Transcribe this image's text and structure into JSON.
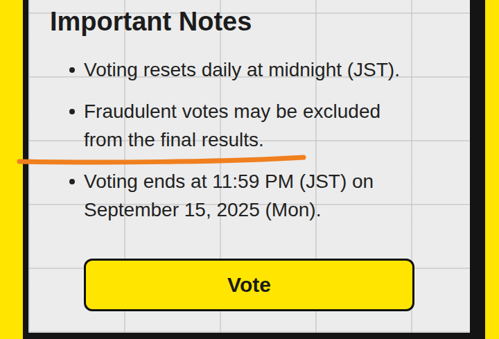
{
  "heading": "Important Notes",
  "notes": [
    {
      "text": "Voting resets daily at midnight (JST).",
      "underlined": false
    },
    {
      "text": "Fraudulent votes may be excluded from the final results.",
      "underlined": true
    },
    {
      "text": "Voting ends at 11:59 PM (JST) on September 15, 2025 (Mon).",
      "underlined": false
    }
  ],
  "button": {
    "label": "Vote"
  }
}
